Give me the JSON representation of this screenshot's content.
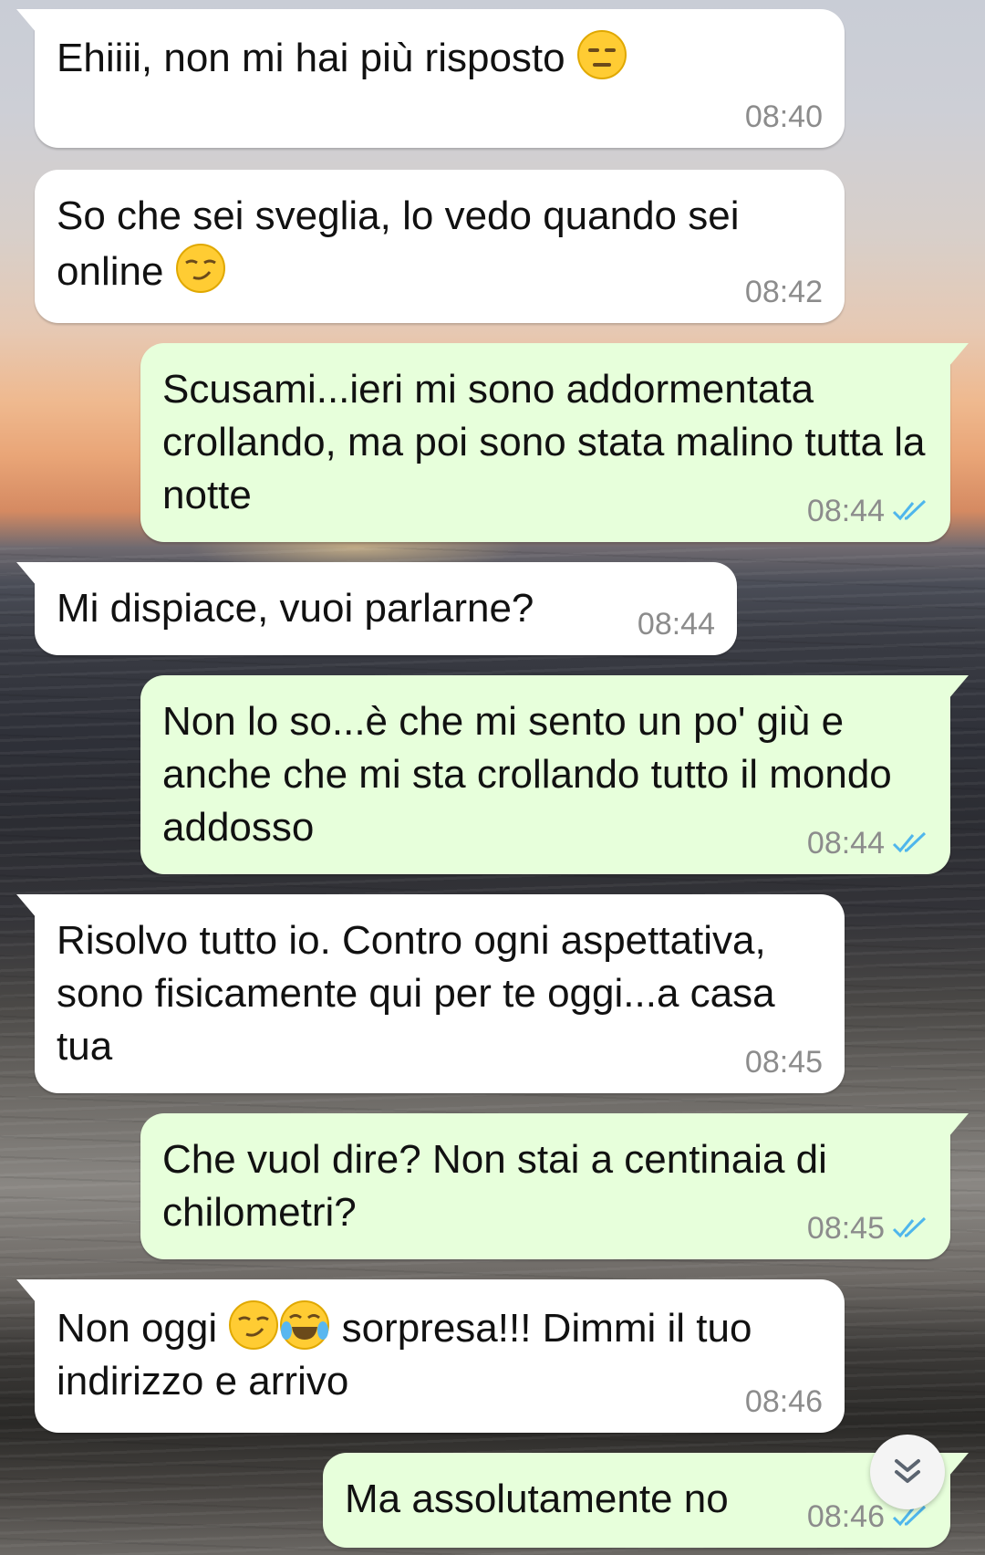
{
  "messages": [
    {
      "text_before": "Ehiiii, non mi hai più risposto ",
      "emoji": "expressionless-face",
      "text_after": "",
      "time": "08:40",
      "direction": "incoming"
    },
    {
      "text_before": "So che sei sveglia, lo vedo quando sei online ",
      "emoji": "smirking-face",
      "text_after": "",
      "time": "08:42",
      "direction": "incoming"
    },
    {
      "text": "Scusami...ieri mi sono addormentata crollando, ma poi sono stata malino tutta la notte",
      "time": "08:44",
      "direction": "outgoing",
      "status": "read"
    },
    {
      "text": "Mi dispiace, vuoi parlarne?",
      "time": "08:44",
      "direction": "incoming"
    },
    {
      "text": "Non lo so...è che mi sento un po' giù e anche che mi sta crollando tutto il mondo addosso",
      "time": "08:44",
      "direction": "outgoing",
      "status": "read"
    },
    {
      "text": "Risolvo tutto io. Contro ogni aspettativa, sono fisicamente qui per te oggi...a casa tua",
      "time": "08:45",
      "direction": "incoming"
    },
    {
      "text": "Che vuol dire? Non stai a centinaia di chilometri?",
      "time": "08:45",
      "direction": "outgoing",
      "status": "read"
    },
    {
      "text_before": "Non oggi ",
      "emoji": "smirking-face",
      "emoji2": "face-with-tears-of-joy",
      "text_after": " sorpresa!!! Dimmi il tuo indirizzo e arrivo",
      "time": "08:46",
      "direction": "incoming"
    },
    {
      "text": "Ma assolutamente no",
      "time": "08:46",
      "direction": "outgoing",
      "status": "read"
    }
  ],
  "colors": {
    "incoming_bubble": "#ffffff",
    "outgoing_bubble": "#e7ffdb",
    "timestamp": "#8c8c8c",
    "read_ticks": "#4fb6ec"
  },
  "scroll_button": {
    "icon": "double-chevron-down-icon"
  }
}
